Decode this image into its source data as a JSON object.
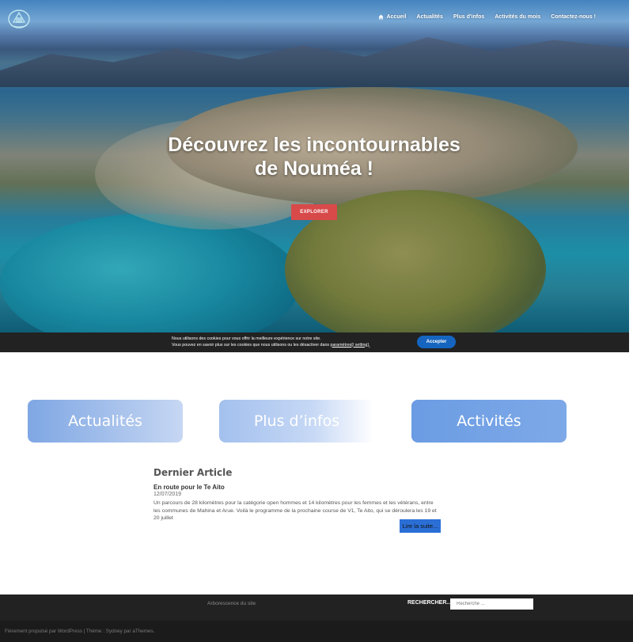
{
  "nav": {
    "items": [
      {
        "label": "Accueil",
        "icon": "home-icon"
      },
      {
        "label": "Actualités"
      },
      {
        "label": "Plus d'infos"
      },
      {
        "label": "Activités du mois"
      },
      {
        "label": "Contactez-nous !"
      }
    ]
  },
  "hero": {
    "title_line1": "Découvrez les incontournables",
    "title_line2": "de Nouméa !",
    "button_label": "EXPLORER"
  },
  "cookie": {
    "line1": "Nous utilisons des cookies pour vous offrir la meilleure expérience sur notre site.",
    "line2_prefix": "Vous pouvez en savoir plus sur les cookies que nous utilisons ou les désactiver dans ",
    "line2_link": "paramètres",
    "line2_suffix": "[/ setting].",
    "accept_label": "Accepter"
  },
  "cards": [
    {
      "label": "Actualités"
    },
    {
      "label": "Plus d’infos"
    },
    {
      "label": "Activités"
    }
  ],
  "article": {
    "section_title": "Dernier Article",
    "title": "En route pour le Te Aito",
    "date": "12/07/2019",
    "excerpt": "Un parcours de 28 kilomètres pour la catégorie open hommes et 14 kilomètres pour les femmes et les vétérans, entre les communes de Mahina et Arue. Voilà le programme de la prochaine course de V1, Te Aito, qui se déroulera les 19 et 20 juillet",
    "read_more_label": "Lire la suite..."
  },
  "footer": {
    "site_tree_label": "Arborescence du site",
    "search_label": "RECHERCHER...",
    "search_placeholder": "Recherche ...",
    "credits": "Fièrement propulsé par WordPress | Thème : Sydney par aThemes."
  },
  "colors": {
    "explore_button": "#d84a4a",
    "accept_button": "#1565c0",
    "read_more": "#2b6fd6",
    "footer_bg": "#222222"
  }
}
